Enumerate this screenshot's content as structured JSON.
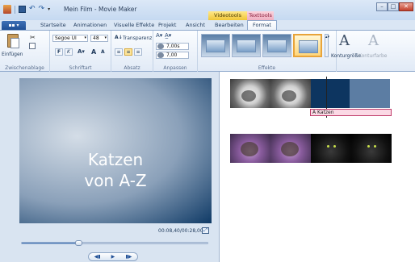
{
  "window": {
    "title": "Mein Film - Movie Maker",
    "context_tabs": [
      "Videotools",
      "Texttools"
    ],
    "controls": [
      "minimize",
      "maximize",
      "close"
    ]
  },
  "qat": {
    "icons": [
      "app-icon",
      "save-icon",
      "undo-icon",
      "redo-icon",
      "customize-dropdown"
    ]
  },
  "tabs": {
    "file": "▪▪ ▾",
    "items": [
      "Startseite",
      "Animationen",
      "Visuelle Effekte",
      "Projekt",
      "Ansicht",
      "Bearbeiten",
      "Format"
    ],
    "active": "Format"
  },
  "ribbon": {
    "clipboard": {
      "paste": "Einfügen",
      "label": "Zwischenablage"
    },
    "font": {
      "family": "Segoe UI",
      "size": "48",
      "label": "Schriftart",
      "bold": "F",
      "italic": "K",
      "grow": "A",
      "shrink": "A"
    },
    "paragraph": {
      "transparency": "Transparenz",
      "label": "Absatz"
    },
    "adjust": {
      "label": "Anpassen",
      "start_time": "7,00s",
      "duration": "7,00"
    },
    "effects": {
      "label": "Effekte"
    },
    "outline": {
      "size": "Konturgröße",
      "color": "Konturfarbe"
    }
  },
  "preview": {
    "slide_text": "Katzen\nvon A-Z",
    "time": "00:08,40/00:28,00",
    "seek_progress": 0.3
  },
  "storyboard": {
    "text_caption": "Katzen"
  }
}
